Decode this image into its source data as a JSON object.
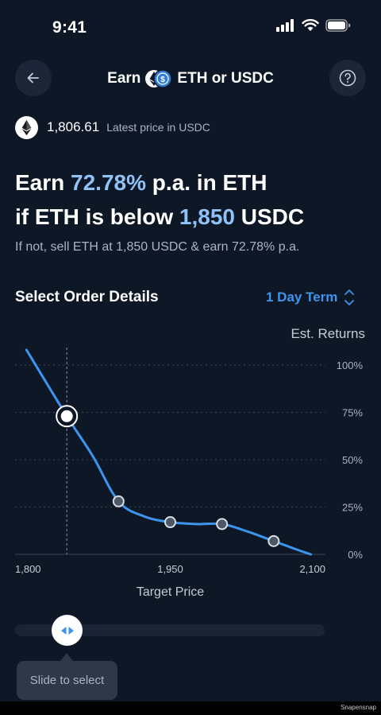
{
  "status_bar": {
    "time": "9:41"
  },
  "header": {
    "title_prefix": "Earn",
    "title_suffix": "ETH or USDC"
  },
  "price": {
    "value": "1,806.61",
    "caption": "Latest price in USDC"
  },
  "headline": {
    "line1_prefix": "Earn ",
    "line1_rate": "72.78%",
    "line1_suffix": " p.a. in ETH",
    "line2_prefix": "if ETH is below ",
    "line2_price": "1,850",
    "line2_suffix": " USDC",
    "subline": "If not, sell ETH at 1,850 USDC & earn 72.78% p.a."
  },
  "order": {
    "section_title": "Select Order Details",
    "term_value": "1 Day Term",
    "est_returns_label": "Est. Returns"
  },
  "slider": {
    "tooltip": "Slide to select"
  },
  "watermark": "Snapensnap",
  "colors": {
    "background": "#0e1726",
    "accent_text": "#8fc2f7",
    "link_blue": "#3d94ee",
    "line": "#3d94ee"
  },
  "chart_data": {
    "type": "line",
    "xlabel": "Target Price",
    "ylabel": "Est. Returns",
    "x_ticks": [
      "1,800",
      "1,950",
      "2,100"
    ],
    "y_ticks": [
      "100%",
      "75%",
      "50%",
      "25%",
      "0%"
    ],
    "xlim": [
      1800,
      2100
    ],
    "ylim": [
      0,
      100
    ],
    "grid": true,
    "selected": {
      "x": 1850,
      "y": 72.78
    },
    "points": [
      {
        "x": 1850,
        "y": 73
      },
      {
        "x": 1900,
        "y": 28
      },
      {
        "x": 1950,
        "y": 17
      },
      {
        "x": 2000,
        "y": 16
      },
      {
        "x": 2050,
        "y": 7
      }
    ],
    "series": [
      {
        "values": [
          {
            "x": 1811,
            "y": 108
          },
          {
            "x": 1850,
            "y": 73
          },
          {
            "x": 1875,
            "y": 52
          },
          {
            "x": 1900,
            "y": 28
          },
          {
            "x": 1925,
            "y": 20
          },
          {
            "x": 1950,
            "y": 17
          },
          {
            "x": 1975,
            "y": 16
          },
          {
            "x": 2000,
            "y": 16
          },
          {
            "x": 2025,
            "y": 12
          },
          {
            "x": 2050,
            "y": 7
          },
          {
            "x": 2075,
            "y": 2
          },
          {
            "x": 2086,
            "y": 0
          }
        ]
      }
    ]
  }
}
